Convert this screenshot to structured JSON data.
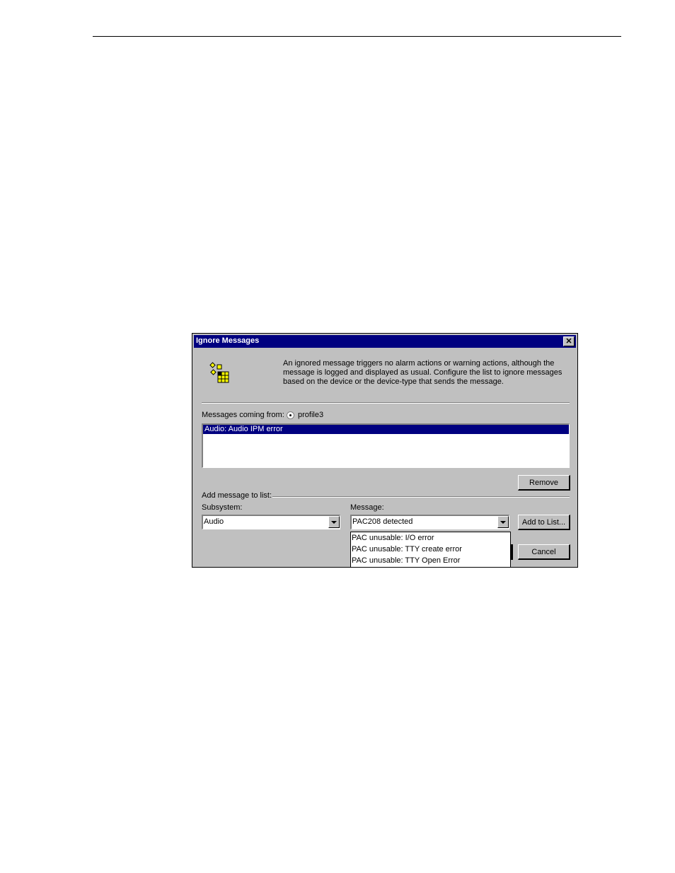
{
  "dialog": {
    "title": "Ignore Messages",
    "close_icon": "close-x-icon",
    "info_icon": "ignore-messages-icon",
    "description": "An ignored message triggers no alarm actions or warning actions, although the message is logged and displayed as usual. Configure the list to ignore messages based on the device or the device-type that sends the message.",
    "messages_from_label": "Messages coming from:",
    "source_option": "profile3",
    "ignored_list": [
      "Audio: Audio IPM error"
    ],
    "remove_label": "Remove",
    "add_message_label": "Add message to list:",
    "subsystem_label": "Subsystem:",
    "subsystem_value": "Audio",
    "message_label": "Message:",
    "message_value": "PAC208 detected",
    "add_to_list_label": "Add to List...",
    "cancel_label": "Cancel",
    "message_options": [
      "PAC unusable: I/O error",
      "PAC unusable: TTY create error",
      "PAC unusable: TTY Open Error"
    ]
  }
}
